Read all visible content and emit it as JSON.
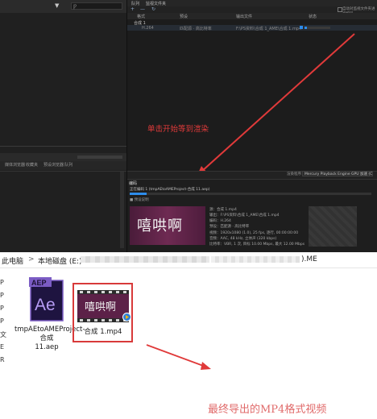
{
  "encoder": {
    "left_panel": {
      "filter_icon": "filter-icon",
      "search_icon": "search-icon",
      "search_glyph": "Ƿ",
      "tabs": [
        "媒体浏览器",
        "收藏夹",
        "预设浏览器",
        "队列"
      ]
    },
    "queue": {
      "tabs": [
        "队列",
        "监视文件夹"
      ],
      "toolbar": [
        "+",
        "—",
        "↻"
      ],
      "auto_encode_label": "自动对监视文件夹进行编码",
      "headers": [
        "格式",
        "预设",
        "输出文件",
        "状态"
      ],
      "group_name": "合成 1",
      "item": {
        "format": "H.264",
        "preset": "匹配源 · 高比特率",
        "output": "F:\\PS资料\\合成 1_AME\\合成 1.mp4",
        "status": "0%"
      },
      "progress": 0.1
    },
    "annotation_start": "单击开始等到渲染",
    "renderer": {
      "label": "渲染程序：",
      "value": "Mercury Playback Engine GPU 加速 (CUDA)"
    },
    "encoding": {
      "tab": "编码",
      "file": "正在编码 1 (tmpAEtoAMEProject-合成 11.aep)",
      "progress": 0.07,
      "section": "■ 预设说明",
      "thumb_text": "嘻哄啊",
      "meta": [
        "源：合成 1.mp4",
        "输出：F:\\PS资料\\合成 1_AME\\合成 1.mp4",
        "编码：H.264",
        "预设：匹配源 · 高比特率",
        "视频：1920x1080 (1.0), 25 fps, 逐行, 00:00:00:00",
        "音频：AAC, 48 kHz, 立体声 (320 kbps)",
        "比特率：VBR, 1 次, 目标 10.00 Mbps, 最大 12.00 Mbps"
      ]
    },
    "colors": {
      "accent": "#2d8ceb",
      "annotation": "#e03a3a"
    }
  },
  "explorer": {
    "address": {
      "root": "此电脑",
      "chevron": ">",
      "drive": "本地磁盘 (E:)",
      "suffix": ").ME"
    },
    "sidebar_chars": [
      "P",
      "P",
      "P",
      "P",
      "文",
      "E",
      "R"
    ],
    "files": [
      {
        "name": "tmpAEtoAMEProject-合成\n11.aep",
        "type": "aep-file-icon",
        "badge": "AEP",
        "glyph": "Ae"
      },
      {
        "name": "合成 1.mp4",
        "type": "mp4-file-icon",
        "thumb_text": "嘻哄啊"
      }
    ],
    "annotation_final": "最终导出的MP4格式视频"
  }
}
